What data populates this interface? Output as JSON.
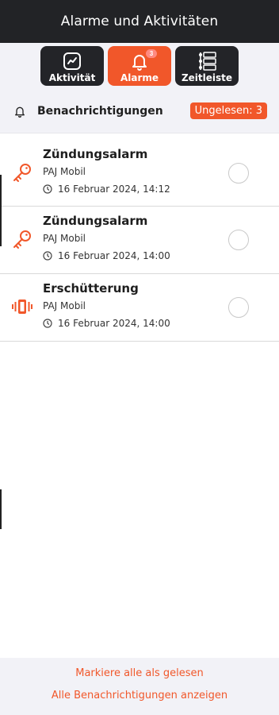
{
  "header": {
    "title": "Alarme und Aktivitäten"
  },
  "tabs": [
    {
      "label": "Aktivität",
      "icon": "activity-chart-icon",
      "active": false
    },
    {
      "label": "Alarme",
      "icon": "bell-icon",
      "active": true,
      "badge": "3"
    },
    {
      "label": "Zeitleiste",
      "icon": "timeline-icon",
      "active": false
    }
  ],
  "notifications": {
    "title": "Benachrichtigungen",
    "unread_label": "Ungelesen: 3",
    "icon": "bell-outline-icon"
  },
  "alarms": [
    {
      "title": "Zündungsalarm",
      "device": "PAJ Mobil",
      "time": "16 Februar 2024, 14:12",
      "icon": "key-icon"
    },
    {
      "title": "Zündungsalarm",
      "device": "PAJ Mobil",
      "time": "16 Februar 2024, 14:00",
      "icon": "key-icon"
    },
    {
      "title": "Erschütterung",
      "device": "PAJ Mobil",
      "time": "16 Februar 2024, 14:00",
      "icon": "vibration-icon"
    }
  ],
  "footer": {
    "mark_all_read": "Markiere alle als gelesen",
    "show_all": "Alle Benachrichtigungen anzeigen"
  },
  "colors": {
    "accent": "#f1572a",
    "header_bg": "#222326",
    "tab_bg": "#232428",
    "panel_bg": "#f2f2f7"
  }
}
